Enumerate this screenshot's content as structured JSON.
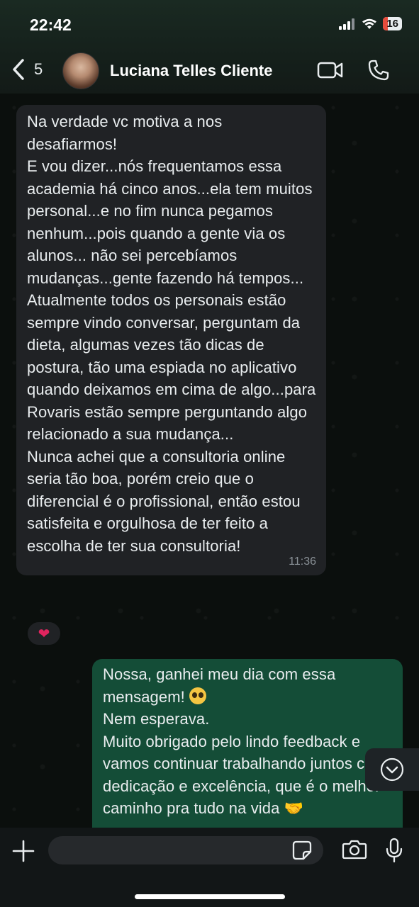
{
  "status_bar": {
    "time": "22:42",
    "battery": "16"
  },
  "header": {
    "back_count": "5",
    "contact_name": "Luciana Telles Cliente"
  },
  "messages": {
    "incoming": {
      "text": "Na verdade vc motiva a nos desafiarmos!\nE vou dizer...nós frequentamos essa academia há cinco anos...ela tem muitos personal...e no fim nunca pegamos nenhum...pois quando a gente via os alunos... não sei percebíamos mudanças...gente fazendo há tempos...\nAtualmente todos os personais estão sempre vindo conversar, perguntam da dieta, algumas vezes tão dicas de postura, tão uma espiada no aplicativo quando deixamos em cima de algo...para Rovaris estão sempre perguntando algo relacionado a sua mudança...\nNunca achei que a consultoria online seria tão boa, porém creio que o diferencial é o profissional, então estou satisfeita e orgulhosa de ter feito a escolha de ter sua consultoria!",
      "time": "11:36",
      "reaction": "❤"
    },
    "outgoing": {
      "line1": "Nossa, ganhei meu dia com essa mensagem!",
      "rest": "Nem esperava.\nMuito obrigado pelo lindo feedback e vamos continuar trabalhando juntos com dedicação e excelência, que é o melhor caminho pra tudo na vida 🤝"
    }
  },
  "composer": {
    "placeholder": ""
  },
  "icons": [
    "back-chevron-icon",
    "video-call-icon",
    "phone-icon",
    "plus-icon",
    "sticker-icon",
    "camera-icon",
    "microphone-icon",
    "chevron-down-icon"
  ]
}
